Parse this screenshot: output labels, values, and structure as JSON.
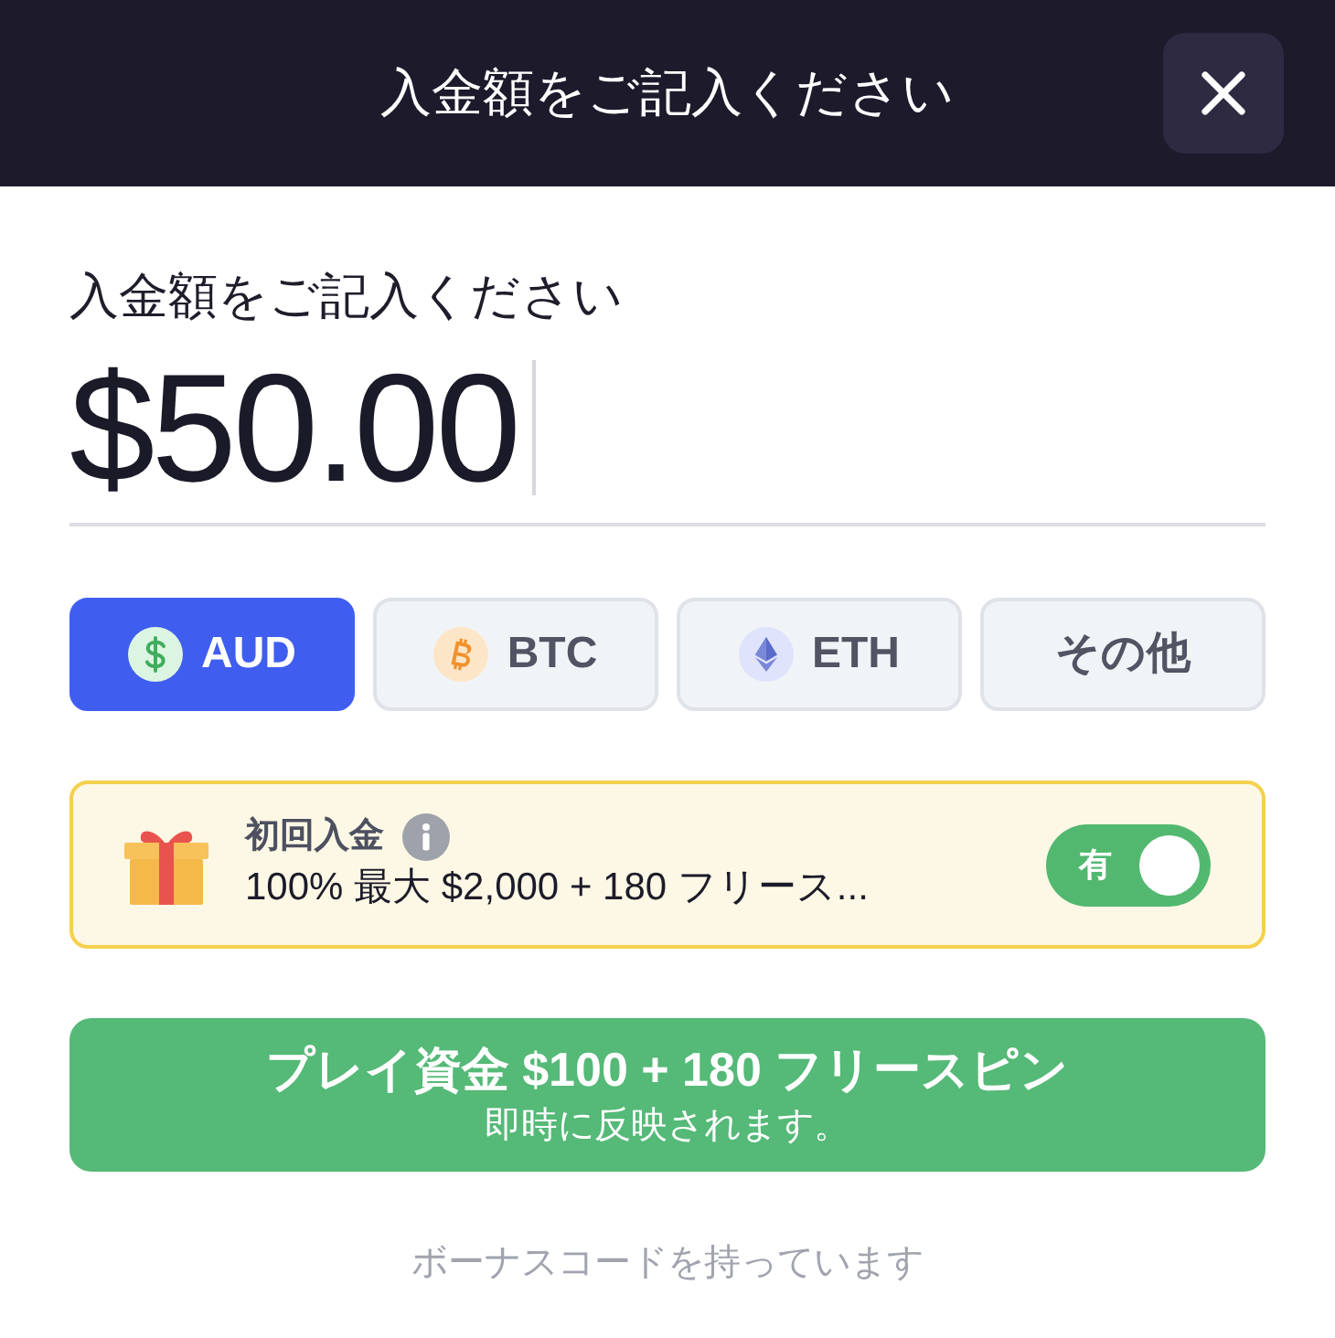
{
  "header": {
    "title": "入金額をご記入ください"
  },
  "amount": {
    "label": "入金額をご記入ください",
    "value": "$50.00"
  },
  "currencies": [
    {
      "label": "AUD",
      "kind": "dollar",
      "selected": true
    },
    {
      "label": "BTC",
      "kind": "bitcoin",
      "selected": false
    },
    {
      "label": "ETH",
      "kind": "ether",
      "selected": false
    },
    {
      "label": "その他",
      "kind": "other",
      "selected": false
    }
  ],
  "bonus": {
    "title": "初回入金",
    "description": "100% 最大 $2,000 + 180 フリース...",
    "toggle": {
      "label": "有",
      "on": true
    }
  },
  "submit": {
    "title": "プレイ資金 $100 + 180 フリースピン",
    "subtitle": "即時に反映されます。"
  },
  "bonus_code_link": "ボーナスコードを持っています"
}
